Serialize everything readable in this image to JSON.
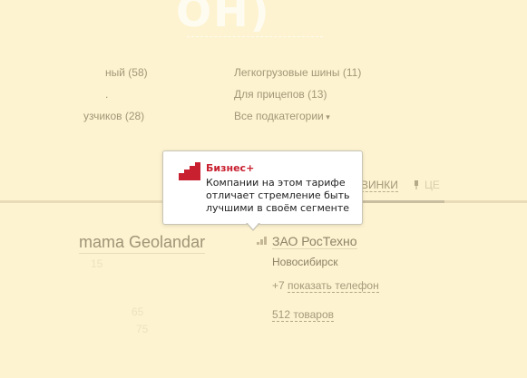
{
  "heading": {
    "fragment": "ОН)"
  },
  "categories": {
    "left_col": [
      {
        "label": "ный (58)"
      },
      {
        "label": "."
      },
      {
        "label": "узчиков (28)"
      }
    ],
    "right_col": [
      {
        "label": "Легкогрузовые шины (11)"
      },
      {
        "label": "Для прицепов (13)"
      },
      {
        "label": "Все подкатегории"
      }
    ]
  },
  "tabs": {
    "fragment_1": "ВИНКИ",
    "fragment_2": "ЦЕ"
  },
  "popup": {
    "title": "Бизнес+",
    "text": "Компании на этом тарифе отличает стремление быть лучшими в своём сегменте",
    "icon": "business-plus-steps-icon",
    "title_color": "#c8202f"
  },
  "left_company": {
    "name": "mama Geolandar",
    "ghost_1": "15",
    "ghost_2": "65",
    "ghost_3": "75"
  },
  "right_company": {
    "name": "ЗАО РосТехно",
    "city": "Новосибирск",
    "phone_prefix": "+7",
    "phone_link": "показать телефон",
    "goods_link": "512 товаров"
  },
  "colors": {
    "overlay_bg": "#fdf3d0",
    "popup_bg": "#ffffff",
    "accent_red": "#c8202f"
  }
}
